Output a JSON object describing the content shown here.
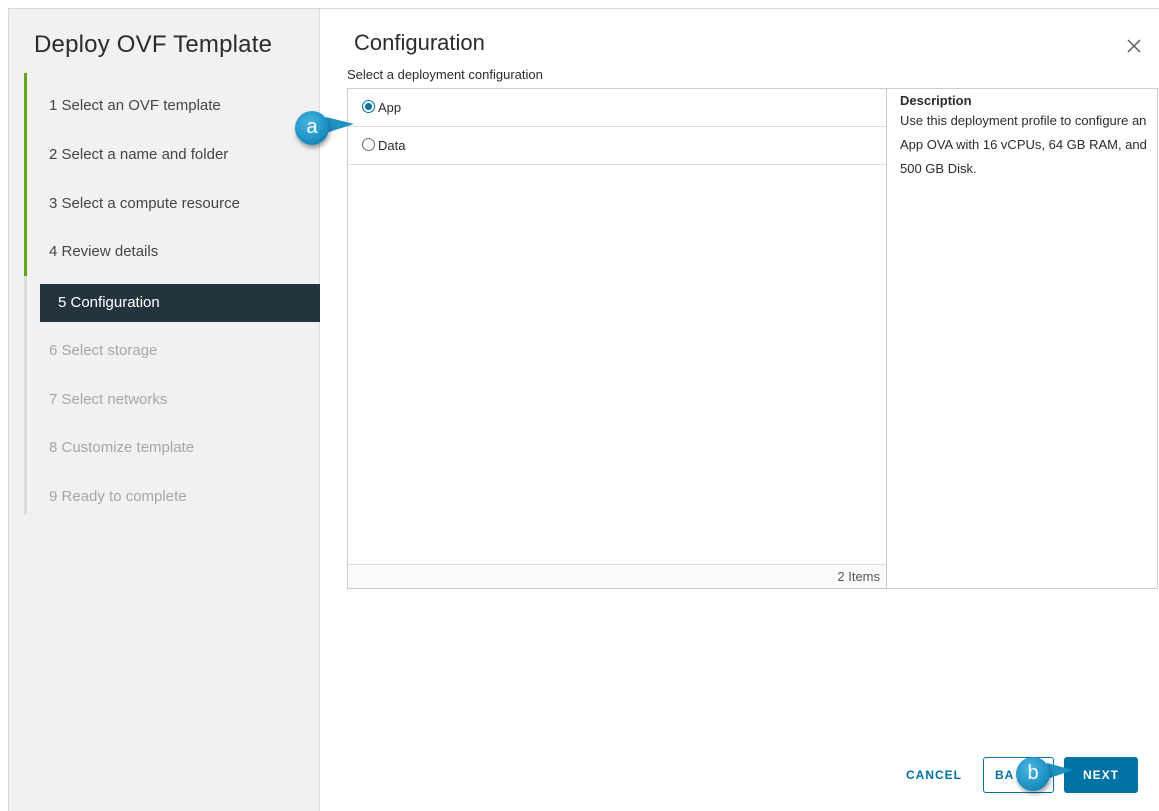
{
  "wizard": {
    "title": "Deploy OVF Template",
    "steps": [
      {
        "label": "1  Select an OVF template",
        "state": "done"
      },
      {
        "label": "2  Select a name and folder",
        "state": "done"
      },
      {
        "label": "3  Select a compute resource",
        "state": "done"
      },
      {
        "label": "4  Review details",
        "state": "done"
      },
      {
        "label": "5  Configuration",
        "state": "active"
      },
      {
        "label": "6  Select storage",
        "state": "future"
      },
      {
        "label": "7  Select networks",
        "state": "future"
      },
      {
        "label": "8  Customize template",
        "state": "future"
      },
      {
        "label": "9  Ready to complete",
        "state": "future"
      }
    ]
  },
  "main": {
    "title": "Configuration",
    "close_icon": "close-icon",
    "subtitle": "Select a deployment configuration",
    "options": [
      {
        "label": "App",
        "selected": true
      },
      {
        "label": "Data",
        "selected": false
      }
    ],
    "footer_count": "2 Items",
    "description": {
      "title": "Description",
      "text": "Use this deployment profile to configure an App OVA with 16 vCPUs, 64 GB RAM, and 500 GB Disk."
    }
  },
  "buttons": {
    "cancel": "CANCEL",
    "back": "BA",
    "next": "NEXT"
  },
  "callouts": {
    "a": "a",
    "b": "b"
  },
  "colors": {
    "accent": "#0072a3",
    "active_step_bg": "#24343f",
    "done_track": "#62a420",
    "callout": "#1d90c4"
  }
}
